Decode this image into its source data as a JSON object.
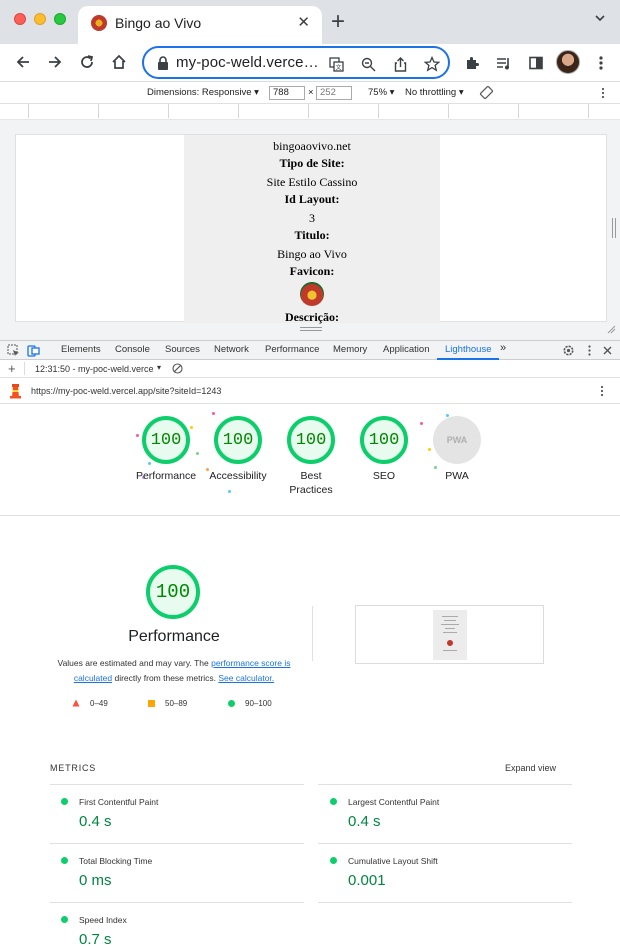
{
  "browser": {
    "tab_title": "Bingo ao Vivo",
    "address": "my-poc-weld.vercel.app/site?siteId=1243"
  },
  "device_toolbar": {
    "dimensions_label": "Dimensions: Responsive",
    "width": "788",
    "height": "252",
    "zoom": "75%",
    "throttling": "No throttling",
    "times_sign": "×"
  },
  "page": {
    "domain": "bingoaovivo.net",
    "tipo_label": "Tipo de Site:",
    "tipo_value": "Site Estilo Cassino",
    "layout_label": "Id Layout:",
    "layout_value": "3",
    "titulo_label": "Titulo:",
    "titulo_value": "Bingo ao Vivo",
    "favicon_label": "Favicon:",
    "descricao_label": "Descrição:"
  },
  "devtools": {
    "tabs": [
      "Elements",
      "Console",
      "Sources",
      "Network",
      "Performance",
      "Memory",
      "Application",
      "Lighthouse"
    ],
    "report_select": "12:31:50 - my-poc-weld.verce",
    "report_url": "https://my-poc-weld.vercel.app/site?siteId=1243"
  },
  "lighthouse": {
    "gauges": [
      {
        "score": "100",
        "label": "Performance"
      },
      {
        "score": "100",
        "label": "Accessibility"
      },
      {
        "score": "100",
        "label": "Best Practices"
      },
      {
        "score": "100",
        "label": "SEO"
      },
      {
        "label": "PWA",
        "badge": "PWA"
      }
    ],
    "perf_score": "100",
    "perf_title": "Performance",
    "desc_prefix": "Values are estimated and may vary. The ",
    "desc_link1": "performance score is calculated",
    "desc_middle": " directly from these metrics. ",
    "desc_link2": "See calculator.",
    "legend": [
      "0–49",
      "50–89",
      "90–100"
    ],
    "metrics_header": "METRICS",
    "expand_view": "Expand view",
    "metrics": [
      {
        "name": "First Contentful Paint",
        "value": "0.4 s"
      },
      {
        "name": "Largest Contentful Paint",
        "value": "0.4 s"
      },
      {
        "name": "Total Blocking Time",
        "value": "0 ms"
      },
      {
        "name": "Cumulative Layout Shift",
        "value": "0.001"
      },
      {
        "name": "Speed Index",
        "value": "0.7 s"
      }
    ]
  },
  "colors": {
    "pass": "#0cce6b",
    "pass_text": "#008800",
    "average": "#ffa400",
    "fail": "#ff4e42",
    "link": "#1a73e8"
  }
}
